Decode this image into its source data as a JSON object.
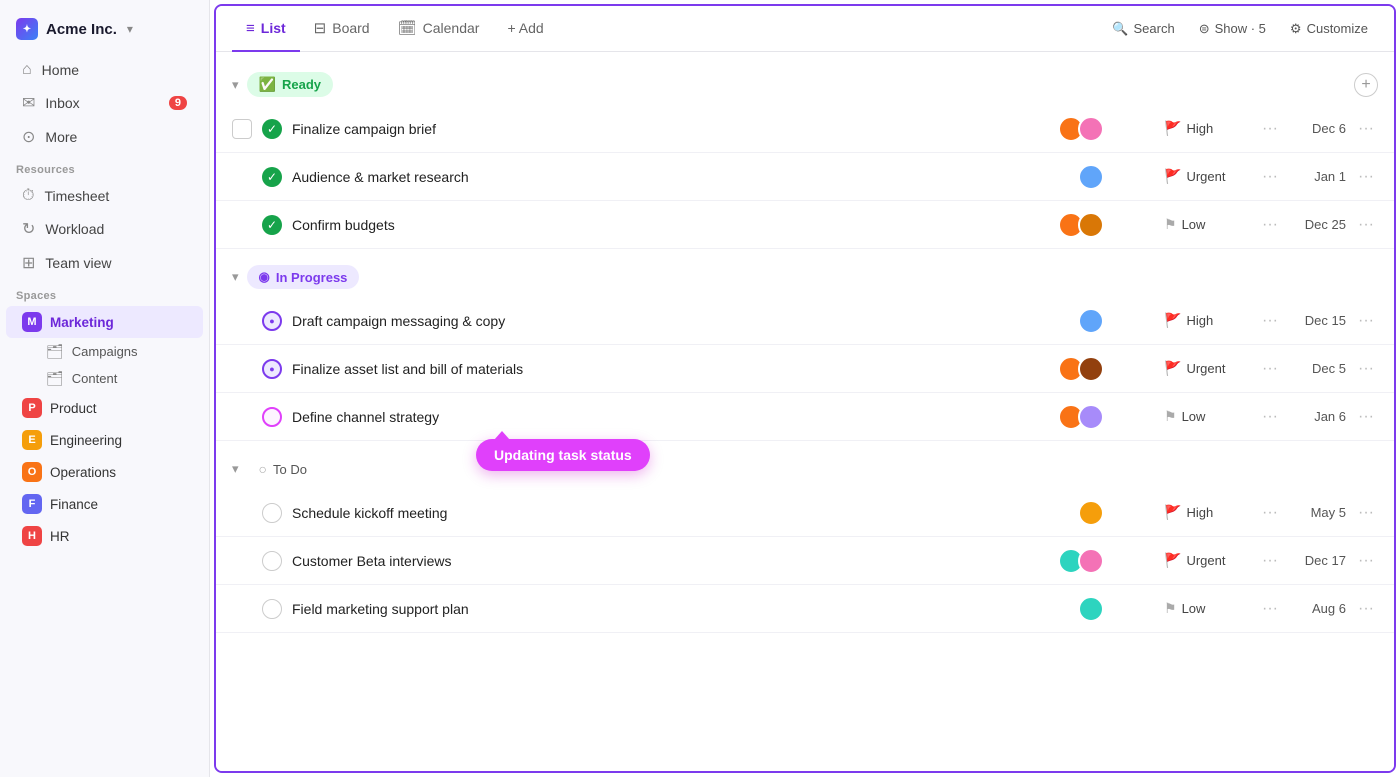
{
  "app": {
    "logo_text": "Acme Inc.",
    "logo_arrow": "▾"
  },
  "sidebar": {
    "nav_items": [
      {
        "id": "home",
        "label": "Home",
        "icon": "⌂"
      },
      {
        "id": "inbox",
        "label": "Inbox",
        "icon": "✉",
        "badge": "9"
      },
      {
        "id": "more",
        "label": "More",
        "icon": "⊙"
      }
    ],
    "resources_label": "Resources",
    "resource_items": [
      {
        "id": "timesheet",
        "label": "Timesheet",
        "icon": "⏱"
      },
      {
        "id": "workload",
        "label": "Workload",
        "icon": "↻"
      },
      {
        "id": "teamview",
        "label": "Team view",
        "icon": "⊞"
      }
    ],
    "spaces_label": "Spaces",
    "spaces": [
      {
        "id": "marketing",
        "label": "Marketing",
        "letter": "M",
        "color": "#7c3aed",
        "active": true
      },
      {
        "id": "product",
        "label": "Product",
        "letter": "P",
        "color": "#ef4444",
        "active": false
      },
      {
        "id": "engineering",
        "label": "Engineering",
        "letter": "E",
        "color": "#f59e0b",
        "active": false
      },
      {
        "id": "operations",
        "label": "Operations",
        "letter": "O",
        "color": "#f97316",
        "active": false
      },
      {
        "id": "finance",
        "label": "Finance",
        "letter": "F",
        "color": "#6366f1",
        "active": false
      },
      {
        "id": "hr",
        "label": "HR",
        "letter": "H",
        "color": "#ef4444",
        "active": false
      }
    ],
    "sub_items": [
      {
        "id": "campaigns",
        "label": "Campaigns"
      },
      {
        "id": "content",
        "label": "Content"
      }
    ]
  },
  "topbar": {
    "tabs": [
      {
        "id": "list",
        "label": "List",
        "icon": "≡",
        "active": true
      },
      {
        "id": "board",
        "label": "Board",
        "icon": "⊟",
        "active": false
      },
      {
        "id": "calendar",
        "label": "Calendar",
        "icon": "📅",
        "active": false
      },
      {
        "id": "add",
        "label": "+ Add",
        "icon": "",
        "active": false
      }
    ],
    "search_label": "Search",
    "show_label": "Show · 5",
    "customize_label": "Customize"
  },
  "sections": [
    {
      "id": "ready",
      "label": "Ready",
      "type": "ready",
      "icon": "✓",
      "tasks": [
        {
          "id": "t1",
          "name": "Finalize campaign brief",
          "status": "done",
          "avatars": [
            "orange",
            "pink"
          ],
          "priority": "High",
          "priority_type": "high",
          "date": "Dec 6",
          "has_checkbox": true
        },
        {
          "id": "t2",
          "name": "Audience & market research",
          "status": "done",
          "avatars": [
            "blue"
          ],
          "priority": "Urgent",
          "priority_type": "urgent",
          "date": "Jan 1",
          "has_checkbox": false
        },
        {
          "id": "t3",
          "name": "Confirm budgets",
          "status": "done",
          "avatars": [
            "orange",
            "amber"
          ],
          "priority": "Low",
          "priority_type": "low",
          "date": "Dec 25",
          "has_checkbox": false
        }
      ]
    },
    {
      "id": "inprogress",
      "label": "In Progress",
      "type": "in-progress",
      "icon": "◉",
      "tasks": [
        {
          "id": "t4",
          "name": "Draft campaign messaging & copy",
          "status": "in-progress",
          "avatars": [
            "blue"
          ],
          "priority": "High",
          "priority_type": "high",
          "date": "Dec 15",
          "has_checkbox": false
        },
        {
          "id": "t5",
          "name": "Finalize asset list and bill of materials",
          "status": "in-progress",
          "avatars": [
            "orange",
            "amber"
          ],
          "priority": "Urgent",
          "priority_type": "urgent",
          "date": "Dec 5",
          "has_checkbox": false
        },
        {
          "id": "t6",
          "name": "Define channel strategy",
          "status": "in-progress",
          "avatars": [
            "orange",
            "purple"
          ],
          "priority": "Low",
          "priority_type": "low",
          "date": "Jan 6",
          "has_checkbox": false,
          "has_tooltip": true,
          "tooltip": "Updating task status"
        }
      ]
    },
    {
      "id": "todo",
      "label": "To Do",
      "type": "todo",
      "icon": "○",
      "tasks": [
        {
          "id": "t7",
          "name": "Schedule kickoff meeting",
          "status": "todo",
          "avatars": [
            "amber"
          ],
          "priority": "High",
          "priority_type": "high",
          "date": "May 5",
          "has_checkbox": false
        },
        {
          "id": "t8",
          "name": "Customer Beta interviews",
          "status": "todo",
          "avatars": [
            "teal",
            "pink"
          ],
          "priority": "Urgent",
          "priority_type": "urgent",
          "date": "Dec 17",
          "has_checkbox": false
        },
        {
          "id": "t9",
          "name": "Field marketing support plan",
          "status": "todo",
          "avatars": [
            "teal"
          ],
          "priority": "Low",
          "priority_type": "low",
          "date": "Aug 6",
          "has_checkbox": false
        }
      ]
    }
  ],
  "colors": {
    "orange": "#f97316",
    "pink": "#ec4899",
    "blue": "#60a5fa",
    "green": "#22c55e",
    "amber": "#f59e0b",
    "purple": "#a78bfa",
    "teal": "#2dd4bf",
    "red": "#ef4444"
  }
}
